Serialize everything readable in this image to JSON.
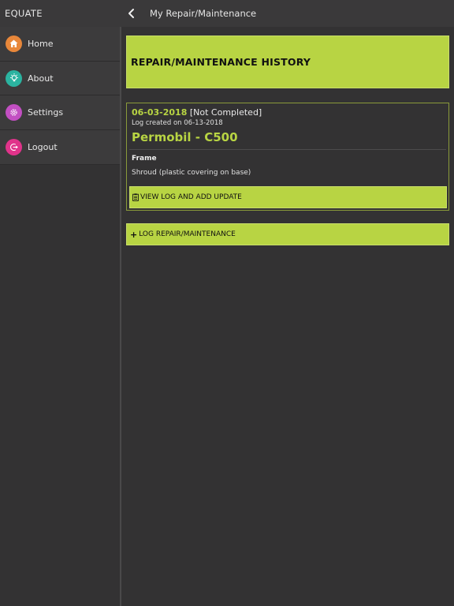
{
  "sidebar": {
    "app_title": "EQUATE",
    "items": [
      {
        "label": "Home",
        "icon": "home-icon",
        "color": "#e8873a"
      },
      {
        "label": "About",
        "icon": "lightbulb-icon",
        "color": "#2bb3a0"
      },
      {
        "label": "Settings",
        "icon": "gear-icon",
        "color": "#c24fc2"
      },
      {
        "label": "Logout",
        "icon": "logout-icon",
        "color": "#e0338a"
      }
    ]
  },
  "header": {
    "title": "My Repair/Maintenance"
  },
  "main": {
    "history_title": "REPAIR/MAINTENANCE HISTORY",
    "log": {
      "date": "06-03-2018",
      "status": "[Not Completed]",
      "created": "Log created on 06-13-2018",
      "device": "Permobil - C500",
      "part": "Frame",
      "description": "Shroud (plastic covering on base)",
      "view_button": "VIEW LOG AND ADD UPDATE"
    },
    "log_repair_button": "LOG REPAIR/MAINTENANCE"
  },
  "colors": {
    "accent": "#b8d443",
    "background": "#333233",
    "header": "#3a393a"
  }
}
